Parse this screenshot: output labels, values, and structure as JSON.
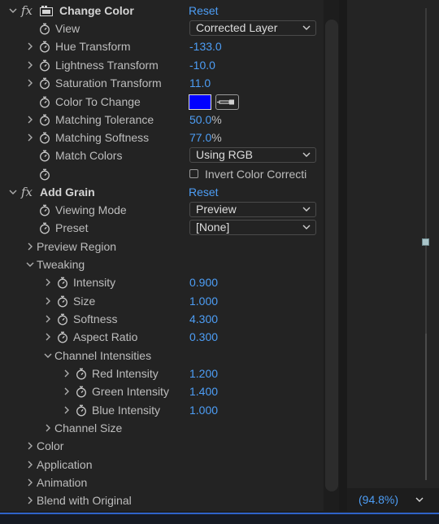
{
  "effects": [
    {
      "name": "Change Color",
      "reset": "Reset",
      "properties": {
        "view": {
          "label": "View",
          "value": "Corrected Layer"
        },
        "hue": {
          "label": "Hue Transform",
          "value": "-133.0"
        },
        "lightness": {
          "label": "Lightness Transform",
          "value": "-10.0"
        },
        "saturation": {
          "label": "Saturation Transform",
          "value": "11.0"
        },
        "color_to_change": {
          "label": "Color To Change",
          "color": "#0000ff"
        },
        "matching_tolerance": {
          "label": "Matching Tolerance",
          "value": "50.0",
          "unit": "%"
        },
        "matching_softness": {
          "label": "Matching Softness",
          "value": "77.0",
          "unit": "%"
        },
        "match_colors": {
          "label": "Match Colors",
          "value": "Using RGB"
        },
        "invert": {
          "label": "Invert Color Correcti",
          "checked": false
        }
      }
    },
    {
      "name": "Add Grain",
      "reset": "Reset",
      "properties": {
        "viewing_mode": {
          "label": "Viewing Mode",
          "value": "Preview"
        },
        "preset": {
          "label": "Preset",
          "value": "[None]"
        },
        "preview_region": {
          "label": "Preview Region"
        },
        "tweaking": {
          "label": "Tweaking",
          "intensity": {
            "label": "Intensity",
            "value": "0.900"
          },
          "size": {
            "label": "Size",
            "value": "1.000"
          },
          "softness": {
            "label": "Softness",
            "value": "4.300"
          },
          "aspect_ratio": {
            "label": "Aspect Ratio",
            "value": "0.300"
          },
          "channel_intensities": {
            "label": "Channel Intensities",
            "red": {
              "label": "Red Intensity",
              "value": "1.200"
            },
            "green": {
              "label": "Green Intensity",
              "value": "1.400"
            },
            "blue": {
              "label": "Blue Intensity",
              "value": "1.000"
            }
          },
          "channel_size": {
            "label": "Channel Size"
          }
        },
        "color": {
          "label": "Color"
        },
        "application": {
          "label": "Application"
        },
        "animation": {
          "label": "Animation"
        },
        "blend": {
          "label": "Blend with Original"
        }
      }
    }
  ],
  "zoom": {
    "value": "(94.8%)"
  },
  "icons": {
    "stopwatch": "stopwatch-icon",
    "twirl": "chevron-icon",
    "fx": "fx-icon",
    "effect": "effect-icon",
    "eyedropper": "eyedropper-icon"
  },
  "colors": {
    "value_blue": "#4d9ef6",
    "panel": "#232323",
    "swatch": "#0000ff"
  }
}
